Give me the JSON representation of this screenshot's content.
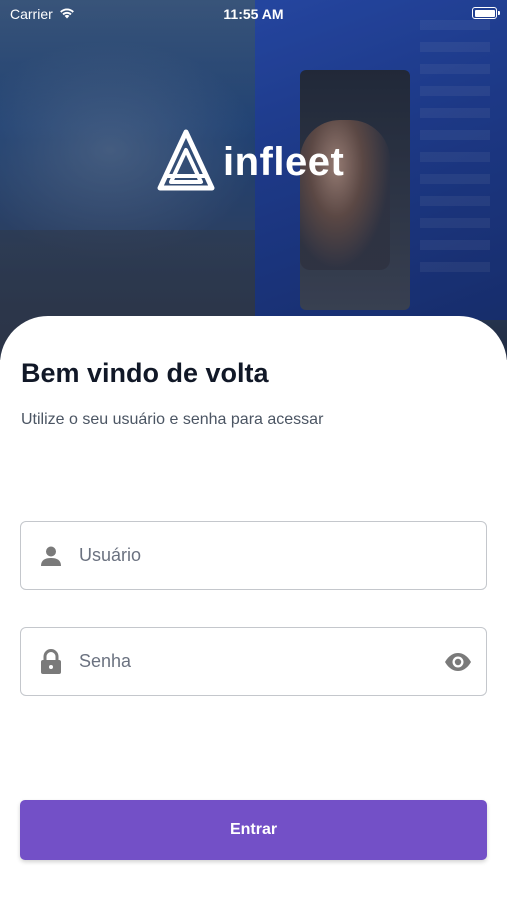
{
  "status_bar": {
    "carrier": "Carrier",
    "time": "11:55 AM"
  },
  "brand": {
    "name": "infleet"
  },
  "login": {
    "title": "Bem vindo de volta",
    "subtitle": "Utilize o seu usuário e senha para acessar",
    "username": {
      "placeholder": "Usuário",
      "value": "",
      "icon": "person-icon"
    },
    "password": {
      "placeholder": "Senha",
      "value": "",
      "icon": "lock-icon",
      "toggle_icon": "eye-icon"
    },
    "submit_label": "Entrar"
  },
  "colors": {
    "accent": "#7350c7",
    "title": "#111827",
    "subtitle": "#4b5563",
    "field_border": "#c4c7cc",
    "icon": "#7a7a7a"
  }
}
